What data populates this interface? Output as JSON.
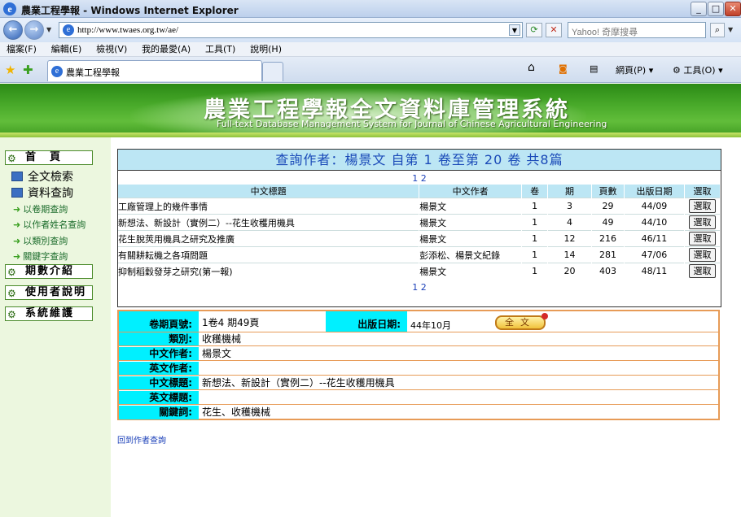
{
  "browser": {
    "window_title": "農業工程學報 - Windows Internet Explorer",
    "url": "http://www.twaes.org.tw/ae/",
    "search_placeholder": "Yahoo! 奇摩搜尋",
    "menu": [
      "檔案(F)",
      "編輯(E)",
      "檢視(V)",
      "我的最愛(A)",
      "工具(T)",
      "說明(H)"
    ],
    "tab_title": "農業工程學報",
    "toolbar": {
      "page_label": "網頁(P)",
      "tools_label": "工具(O)"
    }
  },
  "banner": {
    "title": "農業工程學報全文資料庫管理系統",
    "subtitle": "Full-text Database Management System for Journal of Chinese Agricultural Engineering"
  },
  "sidebar": {
    "home": "首　頁",
    "fulltext": "全文檢索",
    "query": "資料查詢",
    "links": [
      "以卷期查詢",
      "以作者姓名查詢",
      "以類別查詢",
      "關鍵字查詢"
    ],
    "issues": "期數介紹",
    "guide": "使用者說明",
    "maintenance": "系統維護"
  },
  "query": {
    "heading": "查詢作者：楊景文 自第 1 卷至第 20 卷 共8篇",
    "pages": [
      "1",
      "2"
    ],
    "columns": [
      "中文標題",
      "中文作者",
      "卷",
      "期",
      "頁數",
      "出版日期",
      "選取"
    ],
    "rows": [
      {
        "title": "工廠管理上的幾件事情",
        "author": "楊景文",
        "vol": "1",
        "issue": "3",
        "page": "29",
        "date": "44/09",
        "select": "選取"
      },
      {
        "title": "新想法、新設計（實例二）--花生收穫用機具",
        "author": "楊景文",
        "vol": "1",
        "issue": "4",
        "page": "49",
        "date": "44/10",
        "select": "選取"
      },
      {
        "title": "花生脫莢用機具之研究及推廣",
        "author": "楊景文",
        "vol": "1",
        "issue": "12",
        "page": "216",
        "date": "46/11",
        "select": "選取"
      },
      {
        "title": "有關耕耘機之各項問題",
        "author": "彭添松、楊景文紀錄",
        "vol": "1",
        "issue": "14",
        "page": "281",
        "date": "47/06",
        "select": "選取"
      },
      {
        "title": "抑制稻穀發芽之研究(第一報)",
        "author": "楊景文",
        "vol": "1",
        "issue": "20",
        "page": "403",
        "date": "48/11",
        "select": "選取"
      }
    ]
  },
  "detail": {
    "volume_label": "卷期頁號:",
    "volume_value": "1卷4 期49頁",
    "date_label": "出版日期:",
    "date_value": "44年10月",
    "fulltext_button": "全文",
    "category_label": "類別:",
    "category_value": "收穫機械",
    "cn_author_label": "中文作者:",
    "cn_author_value": "楊景文",
    "en_author_label": "英文作者:",
    "en_author_value": "",
    "cn_title_label": "中文標題:",
    "cn_title_value": "新想法、新設計（實例二）--花生收穫用機具",
    "en_title_label": "英文標題:",
    "en_title_value": "",
    "keywords_label": "關鍵詞:",
    "keywords_value": "花生、收穫機械"
  },
  "back_link": "回到作者查詢"
}
